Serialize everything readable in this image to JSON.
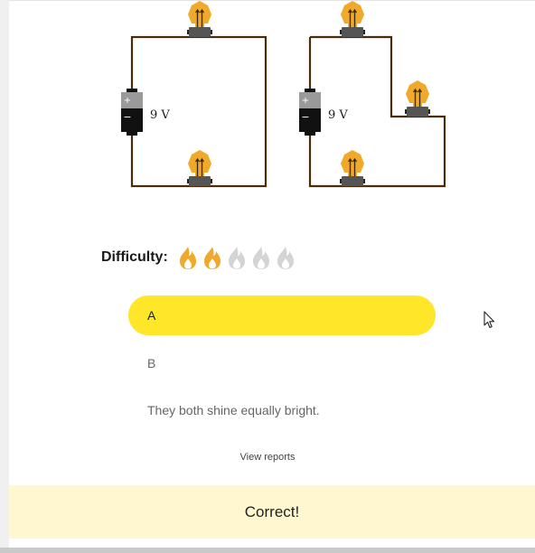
{
  "circuits": {
    "voltage_left": "9 V",
    "voltage_right": "9 V",
    "battery_plus": "+",
    "battery_minus": "−"
  },
  "difficulty": {
    "label": "Difficulty:",
    "level": 2,
    "max": 5,
    "active_color": "#f0a92a",
    "inactive_color": "#d4d4d4"
  },
  "answers": {
    "a_label": "A",
    "b_label": "B",
    "c_label": "They both shine equally bright."
  },
  "links": {
    "view_reports": "View reports"
  },
  "feedback": {
    "message": "Correct!"
  },
  "colors": {
    "wire": "#4a2c0a",
    "bulb": "#f0a92a",
    "selected_option": "#ffe629",
    "feedback_bg": "#fff7d0"
  }
}
